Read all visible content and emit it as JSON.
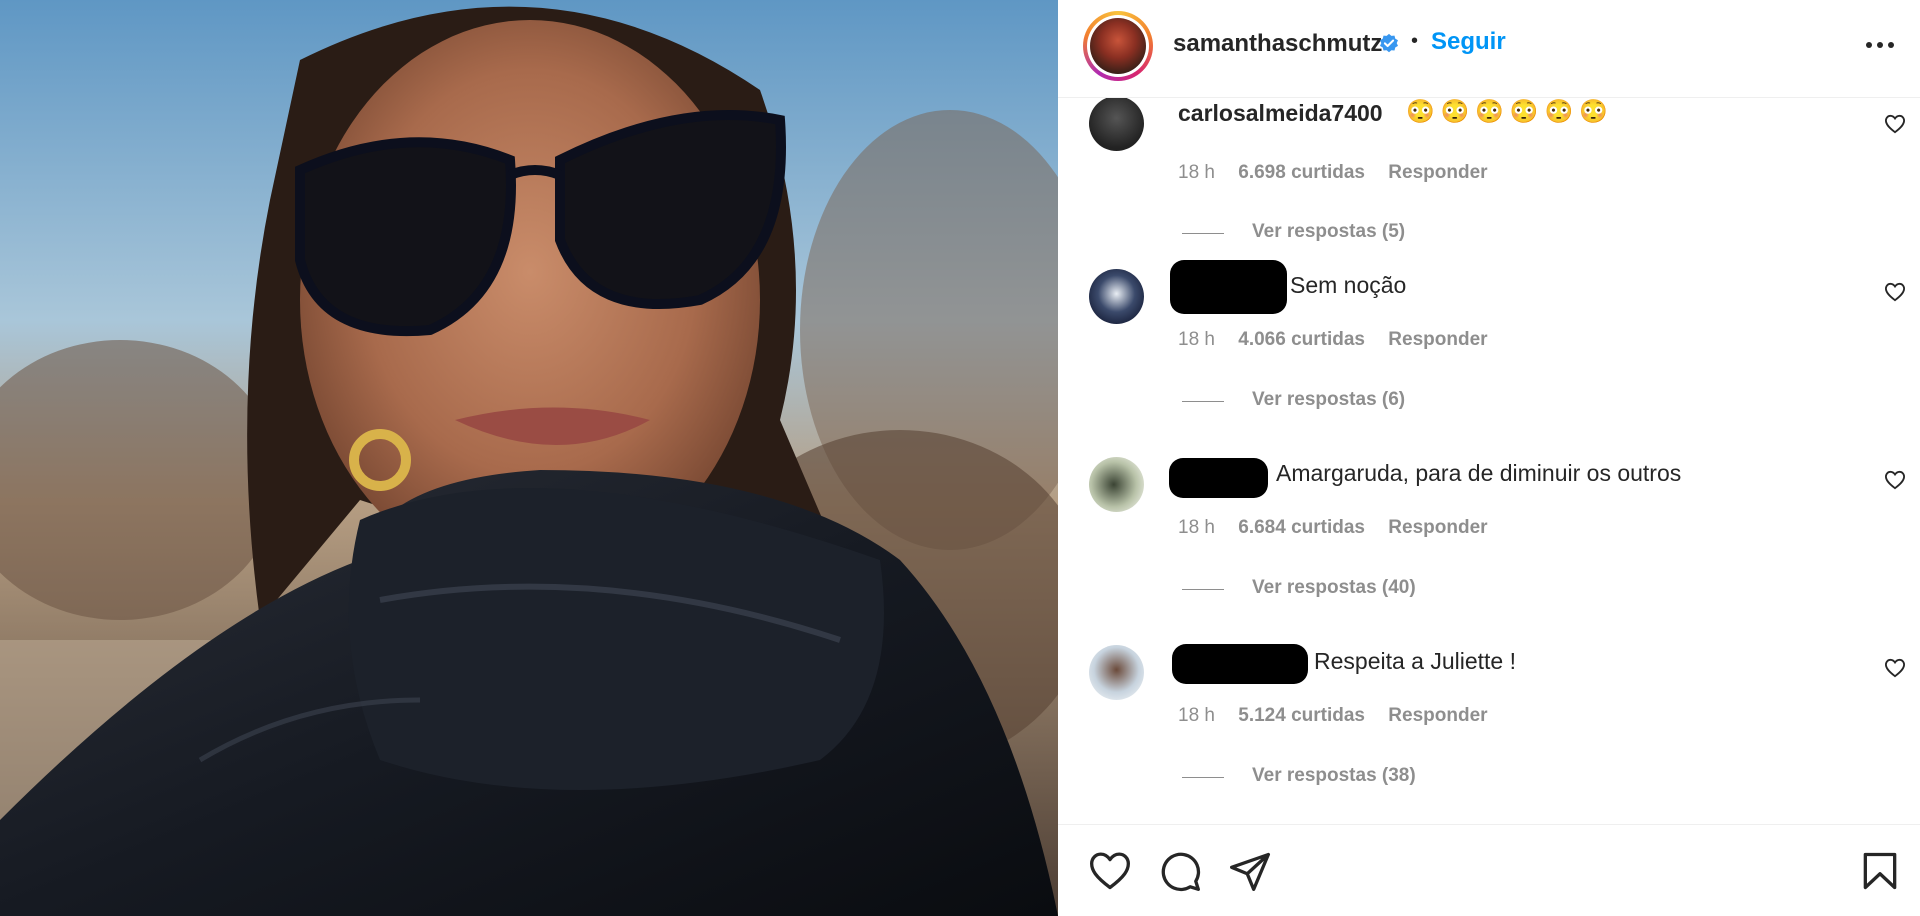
{
  "post": {
    "username": "samanthaschmutz",
    "follow_label": "Seguir",
    "separator": "•"
  },
  "comments": [
    {
      "username": "carlosalmeida7400",
      "text": "😳😳😳😳😳😳",
      "time": "18 h",
      "likes": "6.698 curtidas",
      "reply_label": "Responder",
      "replies_label": "Ver respostas (5)"
    },
    {
      "username": "",
      "text": "Sem noção",
      "time": "18 h",
      "likes": "4.066 curtidas",
      "reply_label": "Responder",
      "replies_label": "Ver respostas (6)"
    },
    {
      "username": "",
      "text": "Amargaruda, para de diminuir os outros",
      "time": "18 h",
      "likes": "6.684 curtidas",
      "reply_label": "Responder",
      "replies_label": "Ver respostas (40)"
    },
    {
      "username": "",
      "text": "Respeita a Juliette !",
      "time": "18 h",
      "likes": "5.124 curtidas",
      "reply_label": "Responder",
      "replies_label": "Ver respostas (38)"
    }
  ],
  "icons": {
    "verified": "verified-badge-icon",
    "more": "more-options-icon",
    "like": "heart-icon",
    "comment": "comment-icon",
    "share": "share-icon",
    "save": "bookmark-icon"
  },
  "colors": {
    "link_blue": "#0095f6",
    "verified_blue": "#3897f0",
    "text_primary": "#262626",
    "text_secondary": "#8e8e8e"
  }
}
